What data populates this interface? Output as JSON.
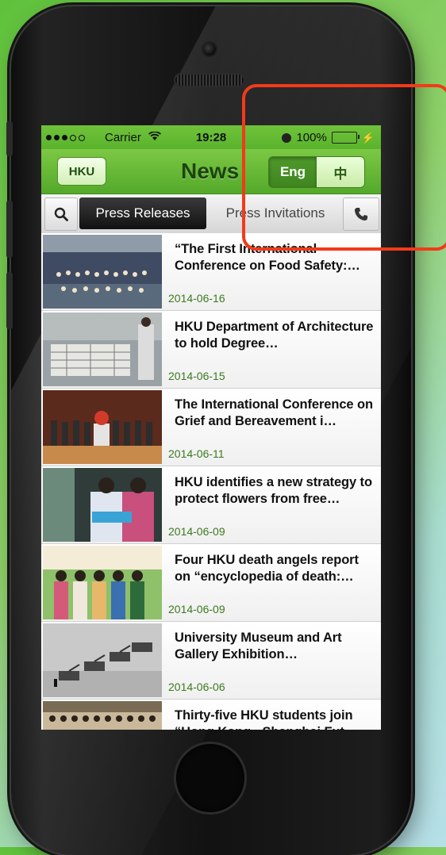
{
  "status_bar": {
    "carrier": "Carrier",
    "time": "19:28",
    "battery": "100%"
  },
  "nav": {
    "hku_button": "HKU",
    "title": "News",
    "lang_eng": "Eng",
    "lang_zh": "中"
  },
  "tabs": {
    "press_releases": "Press Releases",
    "press_invitations": "Press Invitations"
  },
  "articles": [
    {
      "title": "“The First International Conference on Food Safety:…",
      "date": "2014-06-16"
    },
    {
      "title": "HKU Department of Architecture to hold Degree…",
      "date": "2014-06-15"
    },
    {
      "title": "The International Conference on Grief and Bereavement i…",
      "date": "2014-06-11"
    },
    {
      "title": "HKU identifies a new strategy to protect flowers from free…",
      "date": "2014-06-09"
    },
    {
      "title": "Four HKU death angels report on “encyclopedia of death:…",
      "date": "2014-06-09"
    },
    {
      "title": "University Museum and Art Gallery Exhibition…",
      "date": "2014-06-06"
    },
    {
      "title": "Thirty-five HKU students join “Hong Kong - Shanghai Fut…",
      "date": ""
    }
  ],
  "colors": {
    "accent": "#5ab32c",
    "highlight": "#f23a1a",
    "date": "#3c7a1f"
  }
}
